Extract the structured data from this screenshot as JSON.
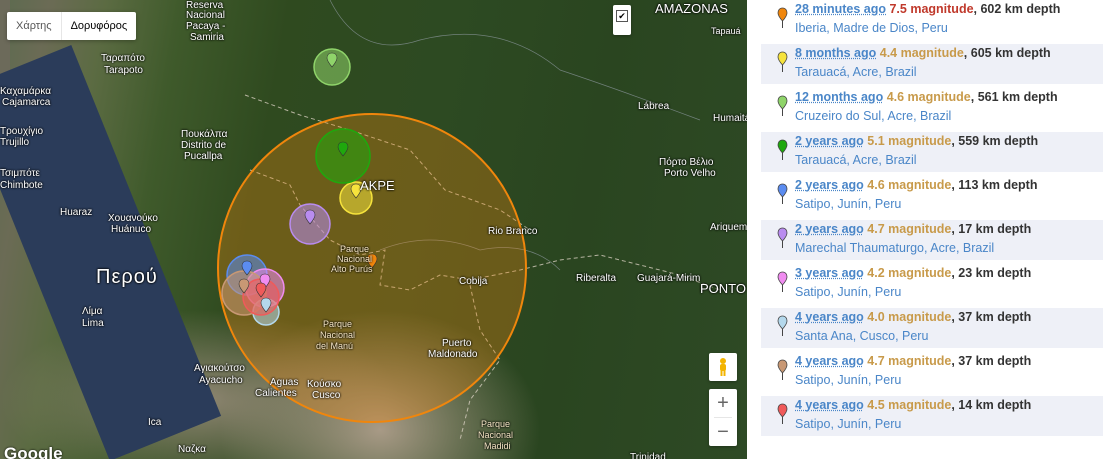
{
  "map": {
    "map_type_buttons": [
      "Χάρτης",
      "Δορυφόρος"
    ],
    "selected_map_type": "Δορυφόρος",
    "checkbox_symbol": "✔",
    "zoom_in_label": "+",
    "zoom_out_label": "−",
    "logo": "Google",
    "labels": {
      "amazonas": "AMAZONAS",
      "tapaua": "Tapauá",
      "reserva1": "Reserva",
      "reserva2": "Nacional",
      "reserva3": "Pacaya -",
      "reserva4": "Samiria",
      "tarapoto1": "Ταραπότο",
      "tarapoto2": "Tarapoto",
      "cajamarca1": "Καχαμάρκα",
      "cajamarca2": "Cajamarca",
      "trujillo1": "Τρουχίγιο",
      "trujillo2": "Trujillo",
      "pucallpa1": "Πουκάλπα",
      "pucallpa2": "Distrito de",
      "pucallpa3": "Pucallpa",
      "labrea": "Lábrea",
      "humaita": "Humaitá",
      "chimbote1": "Τσιμπότε",
      "chimbote2": "Chimbote",
      "portovelho1": "Πόρτο Βέλιο",
      "portovelho2": "Porto Velho",
      "acre": "ΑΚΡΕ",
      "huaraz": "Huaraz",
      "huanuco1": "Χουανούκο",
      "huanuco2": "Huánuco",
      "alto1": "Parque",
      "alto2": "Nacional",
      "alto3": "Alto Purús",
      "riobranco": "Rio Branco",
      "ariquemes": "Ariquemes",
      "peru": "Περού",
      "ribeiralta": "Riberalta",
      "guajara": "Guajará-Mirim",
      "cobija": "Cobija",
      "rondonia": "ΡΟΝΤΟ",
      "lima1": "Λίμα",
      "lima2": "Lima",
      "manu1": "Parque",
      "manu2": "Nacional",
      "manu3": "del Manú",
      "maldonado1": "Puerto",
      "maldonado2": "Maldonado",
      "ayacucho1": "Αγιακούτσο",
      "ayacucho2": "Ayacucho",
      "aguas1": "Aguas",
      "aguas2": "Calientes",
      "cusco1": "Κούσκο",
      "cusco2": "Cusco",
      "ica": "Ica",
      "madidi1": "Parque",
      "madidi2": "Nacional",
      "madidi3": "Madidi",
      "nazca": "Ναζκα",
      "trinidad": "Trinidad"
    }
  },
  "colors": {
    "orange": "#f0860c",
    "yellow": "#f6e33c",
    "lightgreen": "#8fd46a",
    "green": "#1fa80d",
    "blue": "#5b8cf0",
    "purple": "#b98cf0",
    "pink": "#f08cf0",
    "lightblue": "#b4d8ec",
    "tan": "#c89874",
    "red": "#f05a5a"
  },
  "earthquakes": [
    {
      "ago": "28 minutes ago",
      "magnitude": "7.5 magnitude",
      "depth": ", 602 km depth",
      "place": "Iberia, Madre de Dios, Peru",
      "color": "orange"
    },
    {
      "ago": "8 months ago",
      "magnitude": "4.4 magnitude",
      "depth": ", 605 km depth",
      "place": "Tarauacá, Acre, Brazil",
      "color": "yellow"
    },
    {
      "ago": "12 months ago",
      "magnitude": "4.6 magnitude",
      "depth": ", 561 km depth",
      "place": "Cruzeiro do Sul, Acre, Brazil",
      "color": "lightgreen"
    },
    {
      "ago": "2 years ago",
      "magnitude": "5.1 magnitude",
      "depth": ", 559 km depth",
      "place": "Tarauacá, Acre, Brazil",
      "color": "green"
    },
    {
      "ago": "2 years ago",
      "magnitude": "4.6 magnitude",
      "depth": ", 113 km depth",
      "place": "Satipo, Junín, Peru",
      "color": "blue"
    },
    {
      "ago": "2 years ago",
      "magnitude": "4.7 magnitude",
      "depth": ", 17 km depth",
      "place": "Marechal Thaumaturgo, Acre, Brazil",
      "color": "purple"
    },
    {
      "ago": "3 years ago",
      "magnitude": "4.2 magnitude",
      "depth": ", 23 km depth",
      "place": "Satipo, Junín, Peru",
      "color": "pink"
    },
    {
      "ago": "4 years ago",
      "magnitude": "4.0 magnitude",
      "depth": ", 37 km depth",
      "place": "Santa Ana, Cusco, Peru",
      "color": "lightblue"
    },
    {
      "ago": "4 years ago",
      "magnitude": "4.7 magnitude",
      "depth": ", 37 km depth",
      "place": "Satipo, Junín, Peru",
      "color": "tan"
    },
    {
      "ago": "4 years ago",
      "magnitude": "4.5 magnitude",
      "depth": ", 14 km depth",
      "place": "Satipo, Junín, Peru",
      "color": "red"
    }
  ]
}
